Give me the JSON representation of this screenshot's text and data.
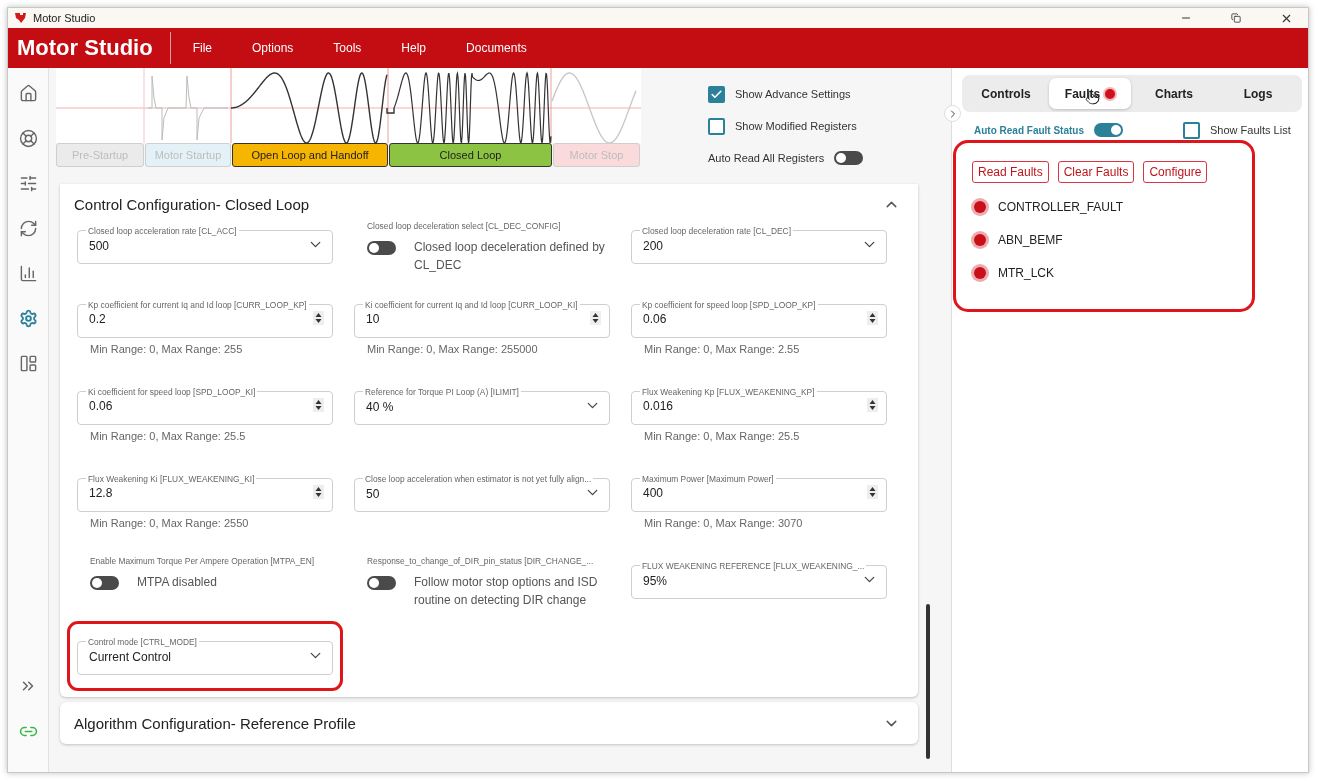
{
  "window": {
    "title": "Motor Studio"
  },
  "header": {
    "app_name": "Motor Studio",
    "menu": [
      "File",
      "Options",
      "Tools",
      "Help",
      "Documents"
    ]
  },
  "nav": [
    {
      "selected": false
    },
    {
      "selected": false
    },
    {
      "selected": false
    },
    {
      "selected": false
    },
    {
      "selected": false
    },
    {
      "selected": true
    },
    {
      "selected": false
    }
  ],
  "connection": {
    "connected": true
  },
  "stages": [
    {
      "label": "Pre-Startup",
      "active": false,
      "color": "#ebebeb"
    },
    {
      "label": "Motor Startup",
      "active": false,
      "color": "#e4f2f8"
    },
    {
      "label": "Open Loop and Handoff",
      "active": true,
      "color": "#f6b500"
    },
    {
      "label": "Closed Loop",
      "active": true,
      "color": "#8cc343"
    },
    {
      "label": "Motor Stop",
      "active": false,
      "color": "#fadada"
    }
  ],
  "options": [
    {
      "kind": "checkbox",
      "label": "Show Advance Settings",
      "checked": true
    },
    {
      "kind": "checkbox",
      "label": "Show Modified Registers",
      "checked": false
    },
    {
      "kind": "toggle",
      "label": "Auto Read All Registers",
      "on": false
    }
  ],
  "sections": [
    {
      "title": "Control Configuration- Closed Loop",
      "expanded": true,
      "fields": [
        {
          "kind": "select",
          "label": "Closed loop acceleration rate [CL_ACC]",
          "value": "500",
          "highlighted": false
        },
        {
          "kind": "toggle",
          "label": "Closed loop deceleration select [CL_DEC_CONFIG]",
          "on": false,
          "text": "Closed loop deceleration defined by CL_DEC",
          "highlighted": false
        },
        {
          "kind": "select",
          "label": "Closed loop deceleration rate [CL_DEC]",
          "value": "200",
          "highlighted": false
        },
        {
          "kind": "number",
          "label": "Kp coefficient for current Iq and Id loop [CURR_LOOP_KP]",
          "value": "0.2",
          "range": "Min Range: 0, Max Range: 255",
          "highlighted": false
        },
        {
          "kind": "number",
          "label": "Ki coefficient for current Iq and Id loop [CURR_LOOP_KI]",
          "value": "10",
          "range": "Min Range: 0, Max Range: 255000",
          "highlighted": false
        },
        {
          "kind": "number",
          "label": "Kp coefficient for speed loop [SPD_LOOP_KP]",
          "value": "0.06",
          "range": "Min Range: 0, Max Range: 2.55",
          "highlighted": false
        },
        {
          "kind": "number",
          "label": "Ki coefficient for speed loop [SPD_LOOP_KI]",
          "value": "0.06",
          "range": "Min Range: 0, Max Range: 25.5",
          "highlighted": false
        },
        {
          "kind": "select",
          "label": "Reference for Torque PI Loop (A) [ILIMIT]",
          "value": "40 %",
          "highlighted": false
        },
        {
          "kind": "number",
          "label": "Flux Weakening Kp [FLUX_WEAKENING_KP]",
          "value": "0.016",
          "range": "Min Range: 0, Max Range: 25.5",
          "highlighted": false
        },
        {
          "kind": "number",
          "label": "Flux Weakening Ki [FLUX_WEAKENING_KI]",
          "value": "12.8",
          "range": "Min Range: 0, Max Range: 2550",
          "highlighted": false
        },
        {
          "kind": "select",
          "label": "Close loop acceleration when estimator is not yet fully align...",
          "value": "50",
          "highlighted": false
        },
        {
          "kind": "number",
          "label": "Maximum Power [Maximum Power]",
          "value": "400",
          "range": "Min Range: 0, Max Range: 3070",
          "highlighted": false
        },
        {
          "kind": "toggle",
          "label": "Enable Maximum Torque Per Ampere Operation [MTPA_EN]",
          "on": false,
          "text": "MTPA disabled",
          "highlighted": false
        },
        {
          "kind": "toggle",
          "label": "Response_to_change_of_DIR_pin_status [DIR_CHANGE_...",
          "on": false,
          "text": "Follow motor stop options and ISD routine on detecting DIR change",
          "highlighted": false
        },
        {
          "kind": "select",
          "label": "FLUX WEAKENING REFERENCE [FLUX_WEAKENING_...",
          "value": "95%",
          "highlighted": false
        },
        {
          "kind": "select",
          "label": "Control mode [CTRL_MODE]",
          "value": "Current Control",
          "highlighted": true
        }
      ]
    },
    {
      "title": "Algorithm Configuration- Reference Profile",
      "expanded": false
    }
  ],
  "panel": {
    "tabs": [
      {
        "label": "Controls",
        "selected": false,
        "alert": false
      },
      {
        "label": "Faults",
        "selected": true,
        "alert": true
      },
      {
        "label": "Charts",
        "selected": false,
        "alert": false
      },
      {
        "label": "Logs",
        "selected": false,
        "alert": false
      }
    ],
    "auto_read": {
      "label": "Auto Read Fault Status",
      "on": true
    },
    "show_list": {
      "label": "Show Faults List",
      "checked": false
    },
    "faults_box": {
      "highlighted": true,
      "buttons": [
        "Read Faults",
        "Clear Faults",
        "Configure"
      ],
      "faults": [
        {
          "name": "CONTROLLER_FAULT",
          "active": true
        },
        {
          "name": "ABN_BEMF",
          "active": true
        },
        {
          "name": "MTR_LCK",
          "active": true
        }
      ]
    }
  }
}
